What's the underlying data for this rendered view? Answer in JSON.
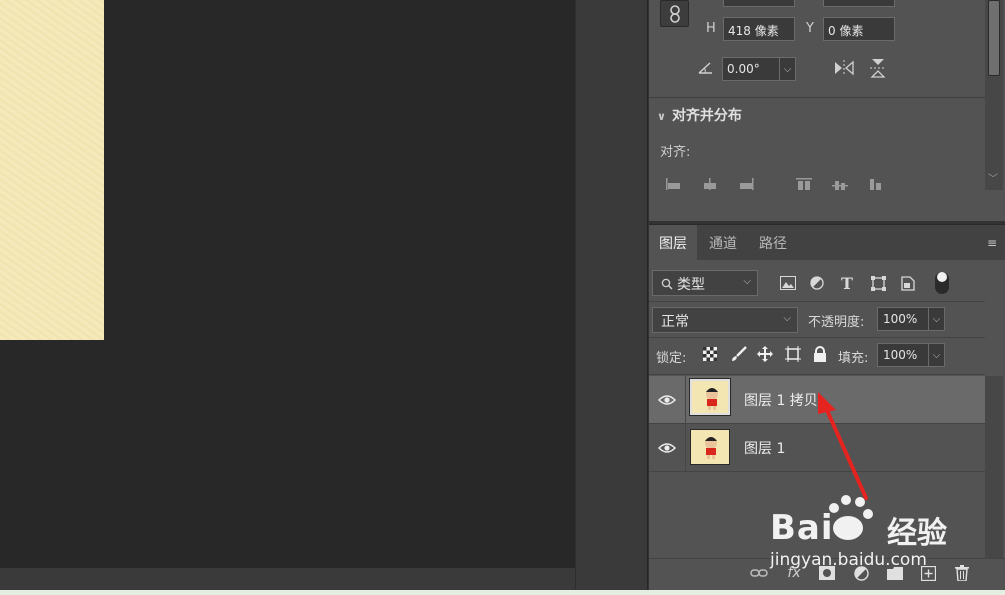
{
  "properties": {
    "h_label": "H",
    "h_value": "418 像素",
    "y_label": "Y",
    "y_value": "0 像素",
    "angle_value": "0.00°",
    "align_section_title": "对齐并分布",
    "align_label": "对齐:"
  },
  "layers_panel": {
    "tabs": [
      {
        "label": "图层",
        "active": true
      },
      {
        "label": "通道",
        "active": false
      },
      {
        "label": "路径",
        "active": false
      }
    ],
    "filter_type": "类型",
    "blend_mode": "正常",
    "opacity_label": "不透明度:",
    "opacity_value": "100%",
    "lock_label": "锁定:",
    "fill_label": "填充:",
    "fill_value": "100%",
    "layers": [
      {
        "name": "图层 1 拷贝",
        "selected": true,
        "visible": true
      },
      {
        "name": "图层 1",
        "selected": false,
        "visible": true
      }
    ],
    "footer_fx": "fx"
  },
  "watermark": {
    "brand": "Bai",
    "brand_cn": "经验",
    "url": "jingyan.baidu.com"
  },
  "colors": {
    "canvas_bg": "#282828",
    "document": "#f3e6b3",
    "panel": "#535353",
    "selected_layer": "#6a6a6a",
    "annotation_arrow": "#e52420"
  }
}
